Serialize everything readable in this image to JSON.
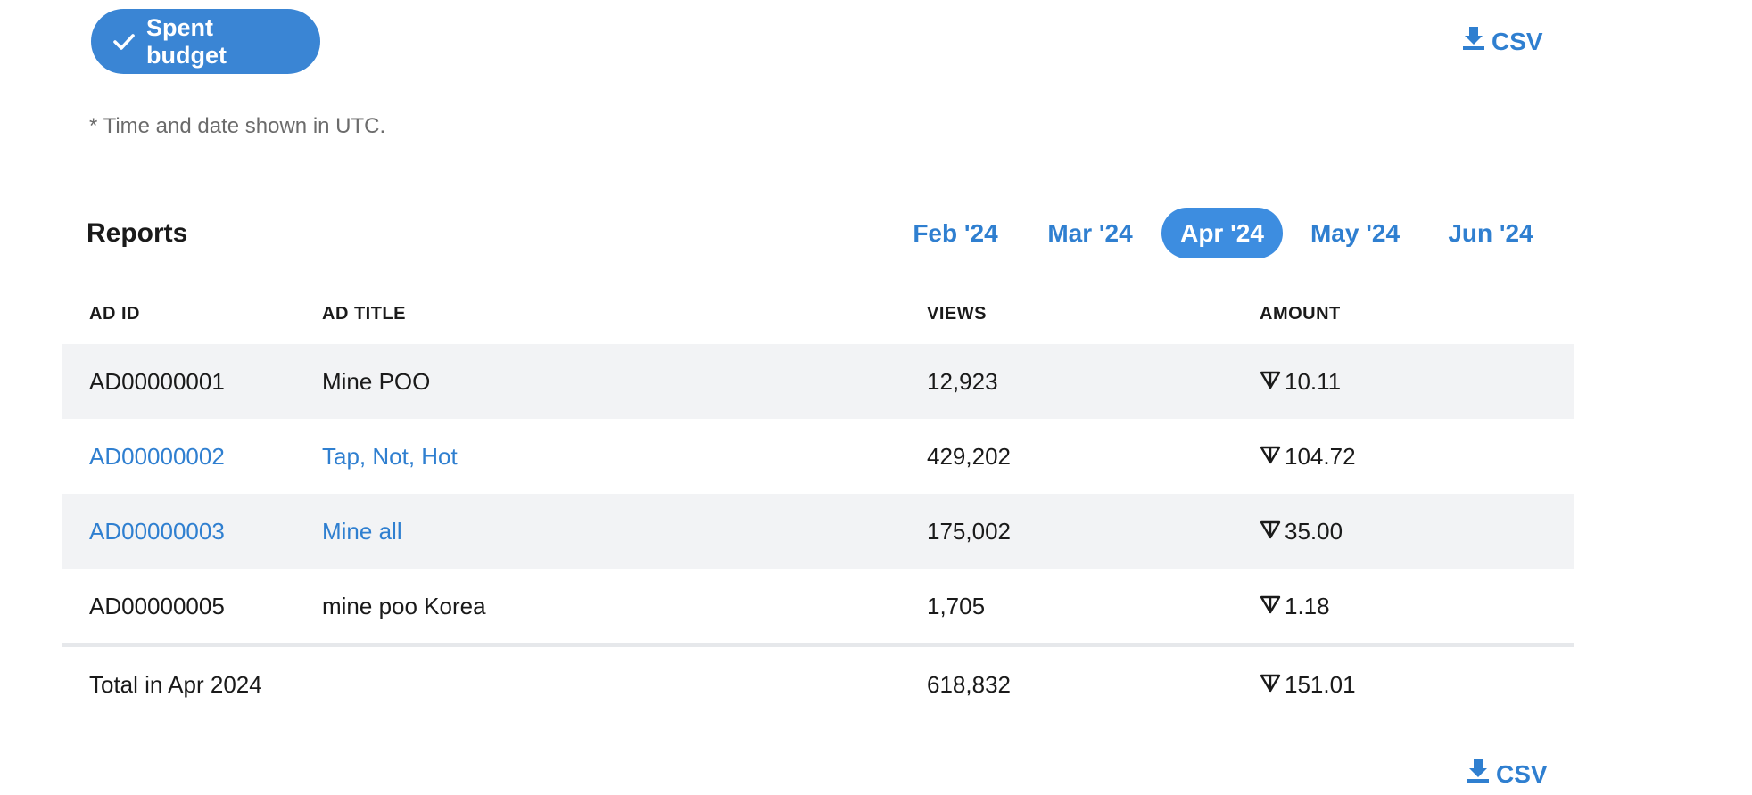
{
  "top_bar": {
    "spent_budget_label": "Spent budget",
    "csv_label": "CSV"
  },
  "utc_note": "* Time and date shown in UTC.",
  "reports": {
    "title": "Reports",
    "months": [
      {
        "label": "Feb '24",
        "active": false
      },
      {
        "label": "Mar '24",
        "active": false
      },
      {
        "label": "Apr '24",
        "active": true
      },
      {
        "label": "May '24",
        "active": false
      },
      {
        "label": "Jun '24",
        "active": false
      }
    ],
    "columns": [
      "AD ID",
      "AD TITLE",
      "VIEWS",
      "AMOUNT"
    ],
    "rows": [
      {
        "id": "AD00000001",
        "title": "Mine POO",
        "views": "12,923",
        "amount": "10.11",
        "link": false
      },
      {
        "id": "AD00000002",
        "title": "Tap, Not, Hot",
        "views": "429,202",
        "amount": "104.72",
        "link": true
      },
      {
        "id": "AD00000003",
        "title": "Mine all",
        "views": "175,002",
        "amount": "35.00",
        "link": true
      },
      {
        "id": "AD00000005",
        "title": "mine poo Korea",
        "views": "1,705",
        "amount": "1.18",
        "link": false
      }
    ],
    "total": {
      "label": "Total in Apr 2024",
      "views": "618,832",
      "amount": "151.01"
    }
  },
  "bottom_bar": {
    "csv_label": "CSV"
  },
  "icons": {
    "check": "check-icon",
    "download": "download-icon",
    "currency": "ton-icon"
  },
  "colors": {
    "accent": "#3a85d4",
    "link": "#2f7fd0",
    "row_shade": "#f2f3f5"
  }
}
